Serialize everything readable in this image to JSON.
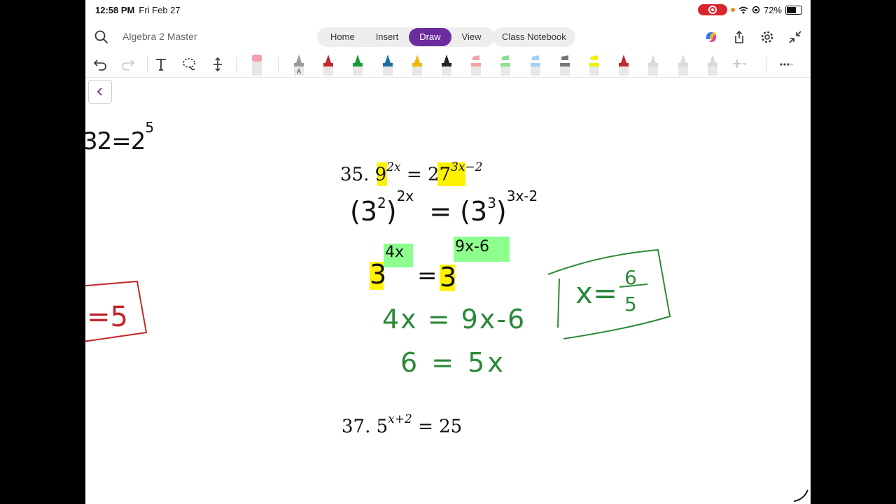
{
  "status": {
    "time": "12:58 PM",
    "date": "Fri Feb 27",
    "battery": "72%",
    "battery_level": 0.72
  },
  "header": {
    "doc_title": "Algebra 2 Master",
    "tabs": [
      {
        "label": "Home",
        "active": false
      },
      {
        "label": "Insert",
        "active": false
      },
      {
        "label": "Draw",
        "active": true
      },
      {
        "label": "View",
        "active": false
      }
    ],
    "notebook_button": "Class Notebook",
    "accent": "#6b2c9e"
  },
  "toolbar": {
    "tools": [
      "undo-icon",
      "redo-icon",
      "text-icon",
      "lasso-icon",
      "space-icon"
    ],
    "pens": [
      {
        "kind": "eraser",
        "color": "#f3a0ae"
      },
      {
        "kind": "pencil",
        "color": "#9a9a9a",
        "label": "A"
      },
      {
        "kind": "pen",
        "color": "#c1272d"
      },
      {
        "kind": "pen",
        "color": "#1a9a3a"
      },
      {
        "kind": "pen",
        "color": "#1a6fa8"
      },
      {
        "kind": "pen",
        "color": "#f2b700"
      },
      {
        "kind": "pen",
        "color": "#222222"
      },
      {
        "kind": "highlighter",
        "color": "#f4a0a8"
      },
      {
        "kind": "highlighter",
        "color": "#8ee08e"
      },
      {
        "kind": "highlighter",
        "color": "#9fd2f4"
      },
      {
        "kind": "highlighter",
        "color": "#777777"
      },
      {
        "kind": "highlighter",
        "color": "#f5f000"
      },
      {
        "kind": "pen",
        "color": "#c1272d"
      },
      {
        "kind": "pen",
        "color": "#d9d9d9"
      },
      {
        "kind": "pen",
        "color": "#d9d9d9"
      },
      {
        "kind": "pen",
        "color": "#d9d9d9"
      }
    ]
  },
  "notes": {
    "left_work": {
      "a": "32=2",
      "exp": "5",
      "boxed": "=5"
    },
    "problem35": {
      "number": "35.",
      "base1": "9",
      "exp1": "2x",
      "eq": "=",
      "base2": "27",
      "exp2": "3x−2"
    },
    "step1": {
      "lhs": "(3",
      "lhs_in": "2",
      "lhs_out": ")",
      "lhs_exp": "2x",
      "eq": "=",
      "rhs": "(3",
      "rhs_in": "3",
      "rhs_out": ")",
      "rhs_exp": "3x-2"
    },
    "step2": {
      "lhs": "3",
      "lhs_exp": "4x",
      "eq": "=",
      "rhs": "3",
      "rhs_exp": "9x-6"
    },
    "step3": "4x = 9x-6",
    "step4": "6 = 5x",
    "answer": {
      "lhs": "x=",
      "num": "6",
      "den": "5"
    },
    "problem37": {
      "number": "37.",
      "base": "5",
      "exp": "x+2",
      "rest": "= 25"
    }
  }
}
